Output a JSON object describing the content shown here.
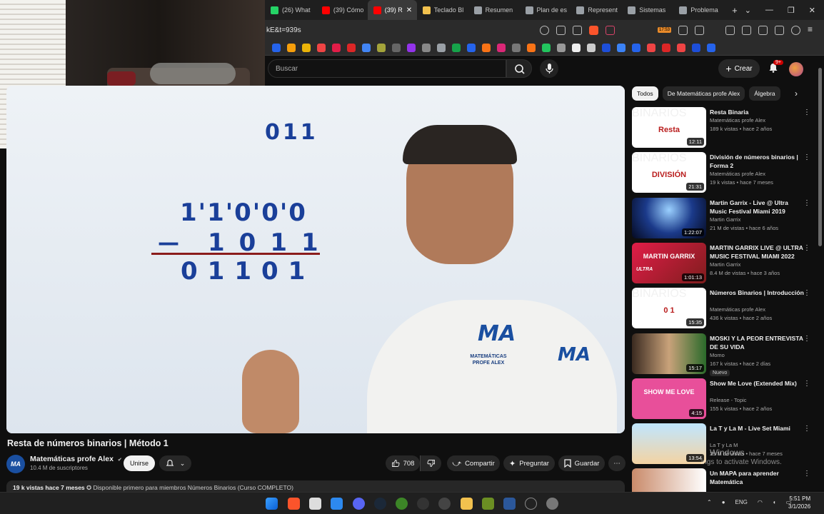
{
  "browser": {
    "tabs": [
      {
        "label": "(26) What",
        "color": "#25d366",
        "active": false
      },
      {
        "label": "(39) Cómo",
        "color": "#ff0000",
        "active": false
      },
      {
        "label": "(39) R",
        "color": "#ff0000",
        "active": true
      },
      {
        "label": "Teclado Bl",
        "color": "#f2c14e",
        "active": false
      },
      {
        "label": "Resumen",
        "color": "#9aa0a6",
        "active": false
      },
      {
        "label": "Plan de es",
        "color": "#9aa0a6",
        "active": false
      },
      {
        "label": "Represent",
        "color": "#9aa0a6",
        "active": false
      },
      {
        "label": "Sistemas",
        "color": "#9aa0a6",
        "active": false
      },
      {
        "label": "Problema",
        "color": "#9aa0a6",
        "active": false
      }
    ],
    "new_tab": "+",
    "window_controls": [
      "⌄",
      "—",
      "❐",
      "✕"
    ],
    "address": "kE&t=939s",
    "ext_badge": "17:53"
  },
  "youtube": {
    "search_placeholder": "Buscar",
    "create_label": "Crear",
    "notif_badge": "9+"
  },
  "video": {
    "top_digits": "011",
    "line1": "1'1'0'0'0",
    "line2_minus": "—",
    "line2": "1011",
    "result": "01101",
    "logo": "MA",
    "shirt_text": "MATEMÁTICAS PROFE ALEX"
  },
  "meta": {
    "title": "Resta de números binarios | Método 1",
    "channel_initials": "MA",
    "channel": "Matemáticas profe Alex",
    "verified": "✔",
    "subscribers": "10.4 M de suscriptores",
    "join": "Unirse",
    "likes": "708",
    "share": "Compartir",
    "ask": "Preguntar",
    "save": "Guardar",
    "more": "⋯",
    "desc_views": "19 k vistas  hace 7 meses",
    "desc_rest": "Disponible primero para miembros  Números Binarios (Curso COMPLETO)"
  },
  "chips": [
    "Todos",
    "De Matemáticas profe Alex",
    "Álgebra"
  ],
  "recommendations": [
    {
      "title": "Resta Binaria",
      "channel": "Matemáticas profe Alex",
      "meta": "189 k vistas • hace 2 años",
      "duration": "12:11",
      "thumb": "bin",
      "thumb_text": "BINARIOS",
      "sub_text": "Resta",
      "nuevo": null
    },
    {
      "title": "División de números binarios | Forma 2",
      "channel": "Matemáticas profe Alex",
      "meta": "19 k vistas • hace 7 meses",
      "duration": "21:31",
      "thumb": "bin",
      "thumb_text": "BINARIOS",
      "sub_text": "DIVISIÓN",
      "nuevo": null
    },
    {
      "title": "Martin Garrix - Live @ Ultra Music Festival Miami 2019",
      "channel": "Martin Garrix",
      "meta": "21 M de vistas • hace 6 años",
      "duration": "1:22:07",
      "thumb": "concert1",
      "thumb_text": "",
      "sub_text": "",
      "nuevo": null
    },
    {
      "title": "MARTIN GARRIX LIVE @ ULTRA MUSIC FESTIVAL MIAMI 2022",
      "channel": "Martin Garrix",
      "meta": "8.4 M de vistas • hace 3 años",
      "duration": "1:01:13",
      "thumb": "concert2",
      "thumb_text": "MARTIN GARRIX",
      "sub_text": "ULTRA",
      "nuevo": null
    },
    {
      "title": "Números Binarios | Introducción",
      "channel": "Matemáticas profe Alex",
      "meta": "436 k vistas • hace 2 años",
      "duration": "15:35",
      "thumb": "bin",
      "thumb_text": "BINARIOS",
      "sub_text": "0 1",
      "nuevo": null
    },
    {
      "title": "MOSKI Y LA PEOR ENTREVISTA DE SU VIDA",
      "channel": "Momo",
      "meta": "167 k vistas • hace 2 días",
      "duration": "15:17",
      "thumb": "moski",
      "thumb_text": "",
      "sub_text": "",
      "nuevo": "Nuevo"
    },
    {
      "title": "Show Me Love (Extended Mix)",
      "channel": "Release - Topic",
      "meta": "155 k vistas • hace 2 años",
      "duration": "4:15",
      "thumb": "pink",
      "thumb_text": "SHOW ME LOVE",
      "sub_text": "",
      "nuevo": null
    },
    {
      "title": "La T y La M - Live Set Miami",
      "channel": "La T y La M",
      "meta": "29 M de vistas • hace 7 meses",
      "duration": "13:54",
      "thumb": "beach",
      "thumb_text": "",
      "sub_text": "",
      "nuevo": null
    },
    {
      "title": "Un MAPA para aprender Matemática",
      "channel": "",
      "meta": "",
      "duration": "",
      "thumb": "mapa",
      "thumb_text": "",
      "sub_text": "",
      "nuevo": null
    }
  ],
  "watermark": {
    "line1": "Windows",
    "line2": "ings to activate Windows."
  },
  "taskbar": {
    "lang": "ENG",
    "time": "5:51 PM",
    "date": "3/1/2026"
  }
}
